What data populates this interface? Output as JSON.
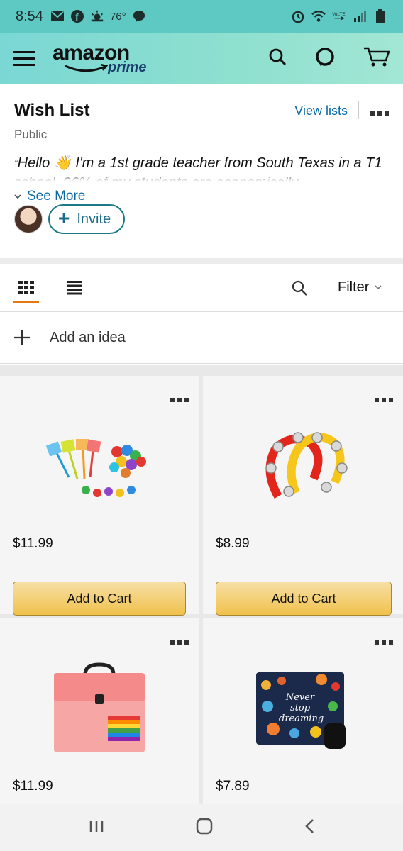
{
  "status_bar": {
    "time": "8:54",
    "temperature": "76°",
    "left_icons": [
      "mail-icon",
      "facebook-icon",
      "weather-icon",
      "chat-bubble-icon"
    ],
    "right_icons": [
      "alarm-icon",
      "wifi-icon",
      "volte-icon",
      "signal-icon",
      "battery-icon"
    ]
  },
  "header": {
    "logo_text": "amazon",
    "logo_sub": "prime",
    "icons": [
      "menu-icon",
      "search-icon",
      "alexa-icon",
      "cart-icon"
    ]
  },
  "wishlist": {
    "title": "Wish List",
    "privacy": "Public",
    "view_lists": "View lists",
    "description": "Hello 👋 I'm a 1st grade teacher from South Texas in a T1 school. 96% of my students are economically",
    "see_more": "See More",
    "invite": "Invite"
  },
  "toolbar": {
    "filter": "Filter",
    "active_view": "grid"
  },
  "add_idea": {
    "label": "Add an idea"
  },
  "products": [
    {
      "price": "$11.99",
      "button": "Add to Cart",
      "image": "fly-swatter-set-image"
    },
    {
      "price": "$8.99",
      "button": "Add to Cart",
      "image": "tambourine-image"
    },
    {
      "price": "$11.99",
      "image": "accordion-file-folder-image"
    },
    {
      "price": "$7.89",
      "image": "never-stop-dreaming-mousepad-image",
      "image_text": "Never stop dreaming"
    }
  ],
  "colors": {
    "status_bar": "#5ec9c3",
    "header": "#8fe0cf",
    "link": "#0a6aa8",
    "accent_underline": "#e47911",
    "button_yellow": "#f0c14b"
  }
}
